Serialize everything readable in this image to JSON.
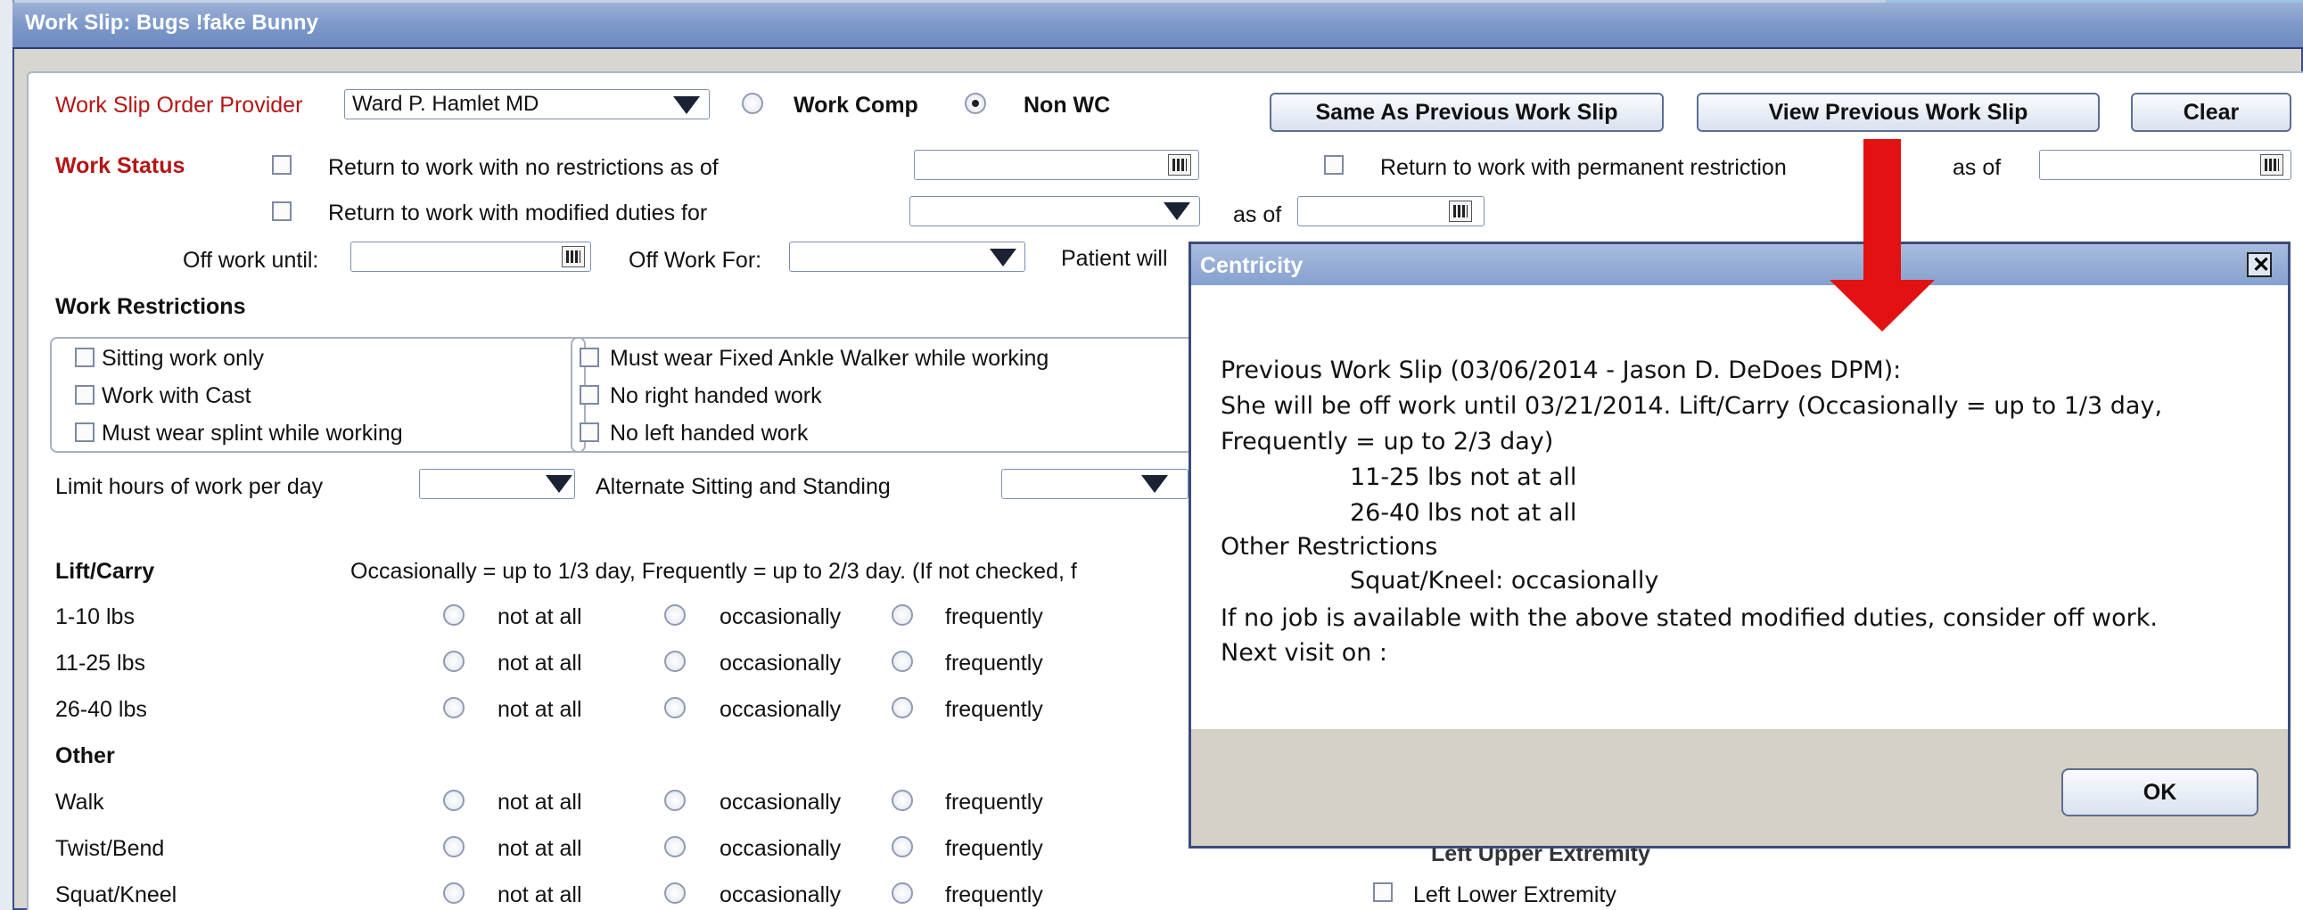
{
  "window": {
    "title": "Work Slip: Bugs !fake Bunny"
  },
  "provider": {
    "label": "Work Slip Order Provider",
    "value": "Ward P. Hamlet MD",
    "radio_work_comp": "Work Comp",
    "radio_non_wc": "Non WC",
    "selected": "Non WC"
  },
  "buttons": {
    "same_as_previous": "Same As Previous Work Slip",
    "view_previous": "View Previous Work Slip",
    "clear": "Clear"
  },
  "work_status": {
    "label": "Work Status",
    "no_restrictions": "Return to work with no restrictions as of",
    "modified_duties": "Return to work with modified duties for",
    "permanent_restrictions": "Return to work with permanent restriction",
    "as_of": "as of",
    "as_of_2": "as of",
    "off_work_until": "Off work until:",
    "off_work_for": "Off Work For:",
    "patient_will": "Patient will"
  },
  "restrictions": {
    "title": "Work Restrictions",
    "left": [
      "Sitting work only",
      "Work with Cast",
      "Must wear splint while working"
    ],
    "right": [
      "Must wear Fixed Ankle Walker while working",
      "No right handed work",
      "No left handed work"
    ],
    "limit_hours": "Limit hours of work per day",
    "alternate": "Alternate Sitting and Standing"
  },
  "lift": {
    "title": "Lift/Carry",
    "note": "Occasionally = up to 1/3 day, Frequently = up to 2/3 day.  (If not checked, f",
    "rows": [
      "1-10 lbs",
      "11-25 lbs",
      "26-40 lbs"
    ]
  },
  "other": {
    "title": "Other",
    "rows": [
      "Walk",
      "Twist/Bend",
      "Squat/Kneel"
    ]
  },
  "options": {
    "not_at_all": "not at all",
    "occasionally": "occasionally",
    "frequently": "frequently"
  },
  "right_partial": {
    "upper": "Left Upper Extremity",
    "lower": "Left Lower Extremity"
  },
  "dialog": {
    "title": "Centricity",
    "lines": [
      "Previous Work Slip (03/06/2014 - Jason D. DeDoes DPM):",
      "She will be off work until 03/21/2014.  Lift/Carry  (Occasionally = up to 1/3 day,",
      "Frequently = up to 2/3 day)",
      "11-25 lbs not at all",
      "26-40 lbs not at all",
      "Other Restrictions",
      "Squat/Kneel: occasionally",
      "If no job is available with the above stated modified duties, consider off work.",
      "Next visit on :"
    ],
    "ok": "OK"
  },
  "colors": {
    "title_bar": "#7b97c8",
    "required_label": "#b31616",
    "annotation_arrow": "#e21212"
  }
}
